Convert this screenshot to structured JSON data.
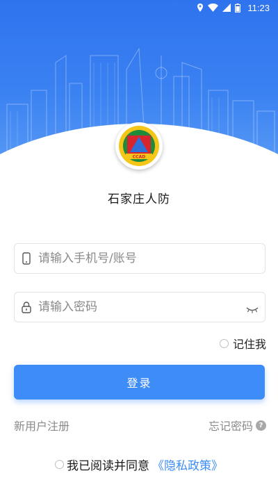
{
  "status_bar": {
    "time": "11:23",
    "icons": [
      "location-icon",
      "wifi-icon",
      "signal-icon",
      "battery-icon"
    ]
  },
  "app": {
    "title": "石家庄人防",
    "logo_text": "CCAD"
  },
  "form": {
    "phone_placeholder": "请输入手机号/账号",
    "password_placeholder": "请输入密码",
    "remember_label": "记住我",
    "login_label": "登录"
  },
  "links": {
    "register": "新用户注册",
    "forgot": "忘记密码",
    "help_glyph": "?"
  },
  "agreement": {
    "text": "我已阅读并同意",
    "policy": "《隐私政策》"
  },
  "colors": {
    "header_blue": "#2f73ee",
    "accent": "#3e8cf7",
    "muted_text": "#8a8a8a"
  }
}
